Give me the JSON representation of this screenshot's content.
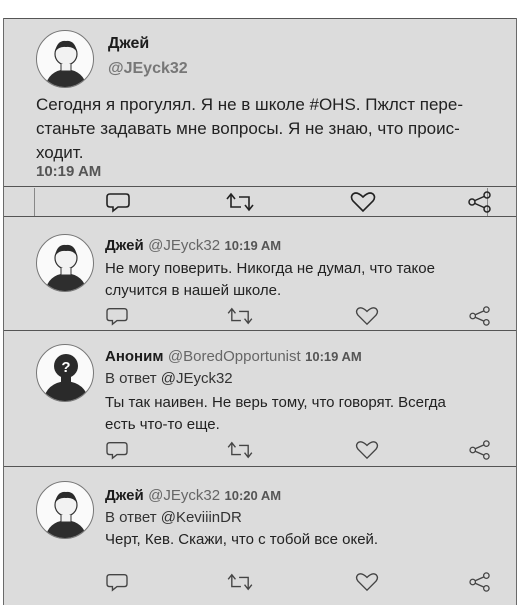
{
  "tweets": [
    {
      "name": "Джей",
      "handle": "@JEyck32",
      "avatar": "person-avatar",
      "text_lines": [
        "Сегодня я прогулял. Я не в школе #OHS. Пжлст пере-",
        "станьте задавать мне вопросы. Я не знаю, что проис-",
        "ходит."
      ],
      "time": "10:19 AM"
    },
    {
      "name": "Джей",
      "handle": "@JEyck32",
      "time": "10:19 AM",
      "avatar": "person-avatar",
      "text_lines": [
        "Не могу поверить. Никогда не думал, что такое",
        "случится в нашей школе."
      ]
    },
    {
      "name": "Аноним",
      "handle": "@BoredOpportunist",
      "time": "10:19 AM",
      "avatar": "anonymous-avatar",
      "reply_to": "В ответ @JEyck32",
      "text_lines": [
        "Ты так наивен. Не верь тому, что говорят. Всегда",
        "есть что-то еще."
      ]
    },
    {
      "name": "Джей",
      "handle": "@JEyck32",
      "time": "10:20 AM",
      "avatar": "person-avatar",
      "reply_to": "В ответ @KeviiinDR",
      "text_lines": [
        "Черт, Кев. Скажи, что с тобой все окей."
      ]
    }
  ],
  "actions": [
    "reply-icon",
    "retweet-icon",
    "like-icon",
    "share-icon"
  ],
  "colors": {
    "background": "#dcdcdc",
    "text": "#1c1c1c",
    "muted": "#666666"
  }
}
